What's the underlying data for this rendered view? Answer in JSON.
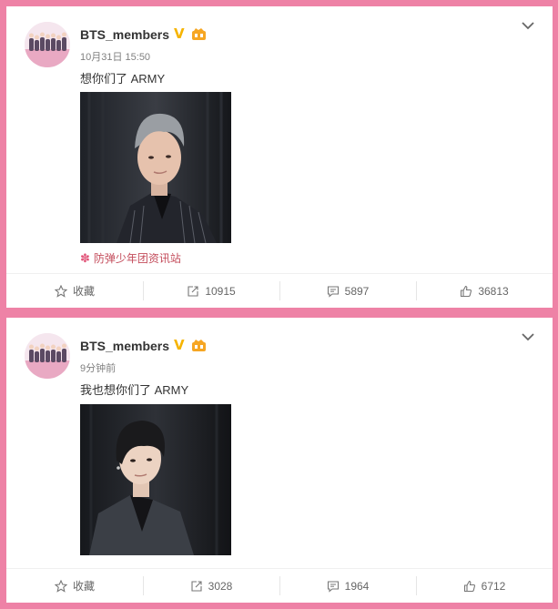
{
  "posts": [
    {
      "user": "BTS_members",
      "time": "10月31日 15:50",
      "text": "想你们了 ARMY",
      "source": "防弹少年团资讯站",
      "actions": {
        "favorite": "收藏",
        "repost": "10915",
        "comment": "5897",
        "like": "36813"
      }
    },
    {
      "user": "BTS_members",
      "time": "9分钟前",
      "text": "我也想你们了 ARMY",
      "actions": {
        "favorite": "收藏",
        "repost": "3028",
        "comment": "1964",
        "like": "6712"
      }
    }
  ],
  "colors": {
    "page_border": "#ee82a6",
    "verified": "#f6b400",
    "source": "#c44d5c"
  },
  "icons": [
    "chevron-down-icon",
    "verified-icon",
    "member-icon",
    "star-icon",
    "repost-icon",
    "comment-icon",
    "like-icon",
    "flower-icon"
  ]
}
